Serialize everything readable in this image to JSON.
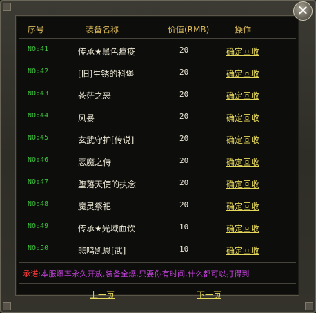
{
  "header": {
    "no": "序号",
    "name": "装备名称",
    "value": "价值(RMB)",
    "action": "操作"
  },
  "rows": [
    {
      "no": "NO:41",
      "name": "传承★黑色瘟疫",
      "value": "20",
      "action": "确定回收"
    },
    {
      "no": "NO:42",
      "name": "[旧]生锈的科堡",
      "value": "20",
      "action": "确定回收"
    },
    {
      "no": "NO:43",
      "name": "苍茫之恶",
      "value": "20",
      "action": "确定回收"
    },
    {
      "no": "NO:44",
      "name": "风暴",
      "value": "20",
      "action": "确定回收"
    },
    {
      "no": "NO:45",
      "name": "玄武守护[传说]",
      "value": "20",
      "action": "确定回收"
    },
    {
      "no": "NO:46",
      "name": "恶魔之侍",
      "value": "20",
      "action": "确定回收"
    },
    {
      "no": "NO:47",
      "name": "堕落天使的执念",
      "value": "20",
      "action": "确定回收"
    },
    {
      "no": "NO:48",
      "name": "魔灵祭祀",
      "value": "20",
      "action": "确定回收"
    },
    {
      "no": "NO:49",
      "name": "传承★光域血饮",
      "value": "10",
      "action": "确定回收"
    },
    {
      "no": "NO:50",
      "name": "悲鸣凯恩[武]",
      "value": "10",
      "action": "确定回收"
    }
  ],
  "notice": {
    "lead": "承诺:",
    "body": "本服爆率永久开放,装备全爆,只要你有时间,什么都可以打得到"
  },
  "pager": {
    "prev": "上一页",
    "next": "下一页"
  },
  "close": "✕",
  "colors": {
    "number": "#3ec23e",
    "header": "#d8b85a",
    "link": "#e6d85a",
    "notice_lead": "#ff3a3a",
    "notice_body": "#c040d8"
  }
}
